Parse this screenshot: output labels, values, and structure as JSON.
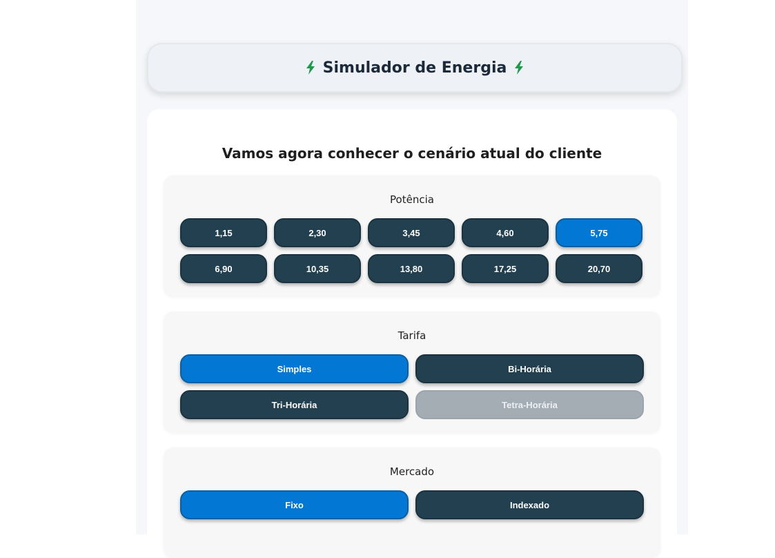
{
  "header": {
    "title": "Simulador de Energia",
    "icon_left": "lightning-bolt-icon",
    "icon_right": "lightning-bolt-icon",
    "icon_color": "#1e9b4a"
  },
  "main": {
    "title": "Vamos agora conhecer o cenário atual do cliente"
  },
  "potencia": {
    "label": "Potência",
    "selected": "5,75",
    "options": [
      "1,15",
      "2,30",
      "3,45",
      "4,60",
      "5,75",
      "6,90",
      "10,35",
      "13,80",
      "17,25",
      "20,70"
    ]
  },
  "tarifa": {
    "label": "Tarifa",
    "selected": "Simples",
    "disabled": "Tetra-Horária",
    "options": [
      "Simples",
      "Bi-Horária",
      "Tri-Horária",
      "Tetra-Horária"
    ]
  },
  "mercado": {
    "label": "Mercado",
    "selected": "Fixo",
    "options": [
      "Fixo",
      "Indexado"
    ]
  },
  "colors": {
    "selected": "#0277d4",
    "default": "#22404f",
    "disabled": "#a3adb3"
  }
}
